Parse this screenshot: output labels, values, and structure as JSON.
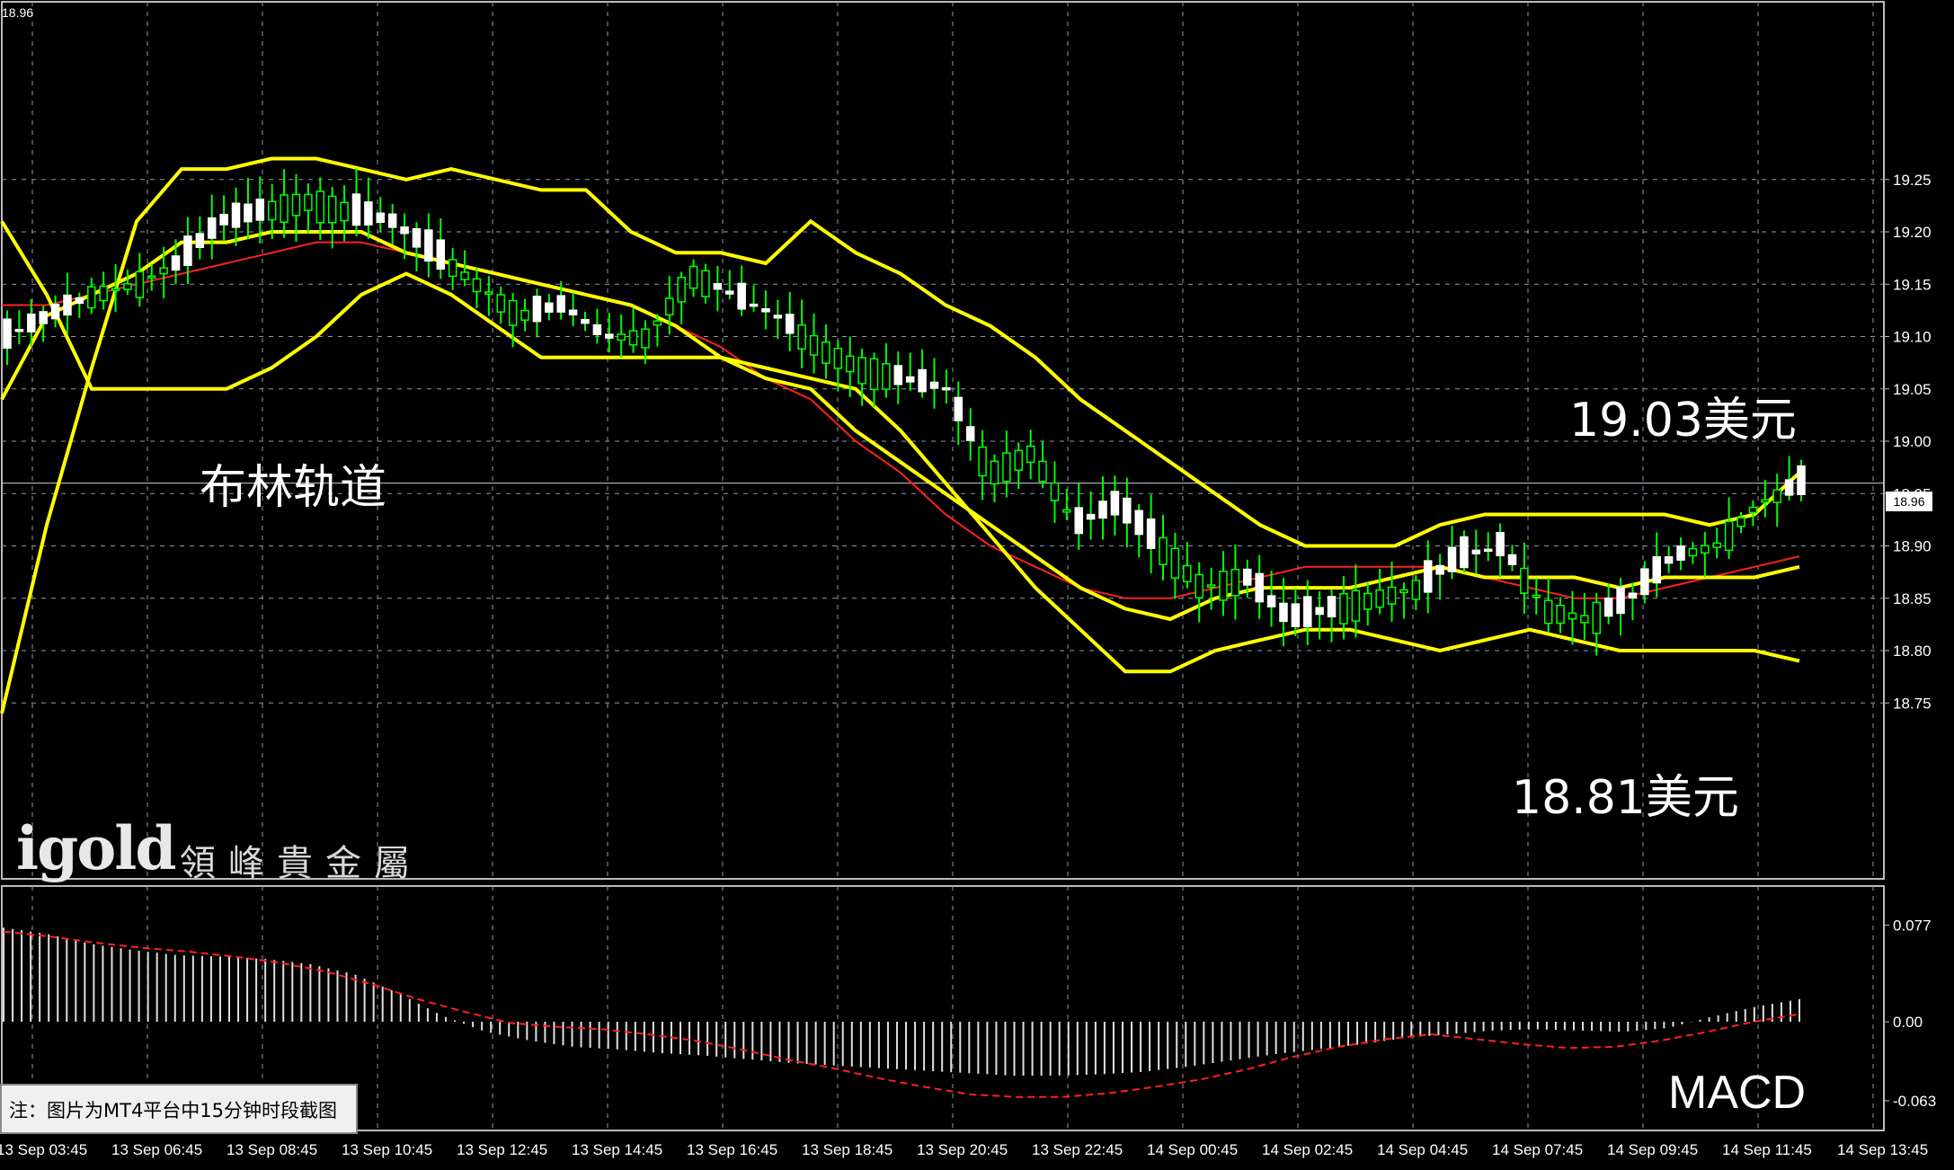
{
  "chart_data": [
    {
      "type": "line",
      "title": "",
      "ylim": [
        18.71,
        19.3
      ],
      "y_ticks": [
        "19.25",
        "19.20",
        "19.15",
        "19.10",
        "19.05",
        "19.00",
        "18.95",
        "18.90",
        "18.85",
        "18.80",
        "18.75"
      ],
      "top_left_label": "18.96",
      "current_price_label": "18.96",
      "current_price": 18.96,
      "grid": true,
      "colors": {
        "candle": "#00ff00",
        "bollinger": "#ffff00",
        "ma": "#ff2020",
        "grid": "#8a9aa8"
      },
      "series": [
        {
          "values": [
            18.74,
            18.92,
            19.07,
            19.21,
            19.26,
            19.26,
            19.27,
            19.27,
            19.26,
            19.25,
            19.26,
            19.25,
            19.24,
            19.24,
            19.2,
            19.18,
            19.18,
            19.17,
            19.21,
            19.18,
            19.16,
            19.13,
            19.11,
            19.08,
            19.04,
            19.01,
            18.98,
            18.95,
            18.92,
            18.9,
            18.9,
            18.9,
            18.92,
            18.93,
            18.93,
            18.93,
            18.93,
            18.93,
            18.92,
            18.93,
            18.97
          ]
        },
        {
          "values": [
            19.04,
            19.12,
            19.14,
            19.16,
            19.19,
            19.19,
            19.2,
            19.2,
            19.2,
            19.18,
            19.17,
            19.16,
            19.15,
            19.14,
            19.13,
            19.11,
            19.08,
            19.06,
            19.05,
            19.01,
            18.98,
            18.95,
            18.92,
            18.89,
            18.86,
            18.84,
            18.83,
            18.85,
            18.86,
            18.86,
            18.86,
            18.87,
            18.88,
            18.87,
            18.87,
            18.87,
            18.86,
            18.87,
            18.87,
            18.87,
            18.88
          ]
        },
        {
          "values": [
            19.13,
            19.13,
            19.14,
            19.15,
            19.16,
            19.17,
            19.18,
            19.19,
            19.19,
            19.18,
            19.17,
            19.16,
            19.15,
            19.14,
            19.13,
            19.11,
            19.09,
            19.06,
            19.04,
            19.0,
            18.97,
            18.93,
            18.9,
            18.88,
            18.86,
            18.85,
            18.85,
            18.86,
            18.87,
            18.88,
            18.88,
            18.88,
            18.88,
            18.87,
            18.86,
            18.85,
            18.85,
            18.86,
            18.87,
            18.88,
            18.89
          ]
        },
        {
          "values": [
            19.21,
            19.14,
            19.05,
            19.05,
            19.05,
            19.05,
            19.07,
            19.1,
            19.14,
            19.16,
            19.14,
            19.11,
            19.08,
            19.08,
            19.08,
            19.08,
            19.08,
            19.07,
            19.06,
            19.05,
            19.01,
            18.96,
            18.91,
            18.86,
            18.82,
            18.78,
            18.78,
            18.8,
            18.81,
            18.82,
            18.82,
            18.81,
            18.8,
            18.81,
            18.82,
            18.81,
            18.8,
            18.8,
            18.8,
            18.8,
            18.79
          ]
        },
        {
          "values": [
            19.1,
            19.12,
            19.14,
            19.15,
            19.17,
            19.21,
            19.22,
            19.23,
            19.22,
            19.21,
            19.18,
            19.15,
            19.12,
            19.13,
            19.1,
            19.1,
            19.16,
            19.14,
            19.12,
            19.09,
            19.07,
            19.06,
            19.05,
            18.97,
            18.99,
            18.92,
            18.94,
            18.9,
            18.86,
            18.87,
            18.83,
            18.84,
            18.85,
            18.86,
            18.89,
            18.9,
            18.84,
            18.83,
            18.85,
            18.89,
            18.9,
            18.94,
            18.96
          ]
        }
      ]
    },
    {
      "type": "bar",
      "title": "",
      "ylim": [
        -0.063,
        0.077
      ],
      "y_ticks": [
        "0.077",
        "0.00",
        "-0.063"
      ],
      "values": [
        0.075,
        0.07,
        0.062,
        0.057,
        0.053,
        0.052,
        0.05,
        0.046,
        0.038,
        0.023,
        0.005,
        -0.008,
        -0.015,
        -0.02,
        -0.022,
        -0.025,
        -0.027,
        -0.03,
        -0.033,
        -0.035,
        -0.037,
        -0.039,
        -0.041,
        -0.043,
        -0.043,
        -0.042,
        -0.04,
        -0.036,
        -0.031,
        -0.026,
        -0.022,
        -0.018,
        -0.013,
        -0.01,
        -0.007,
        -0.006,
        -0.007,
        -0.008,
        -0.005,
        0.004,
        0.012,
        0.018
      ],
      "signal": [
        0.072,
        0.068,
        0.063,
        0.059,
        0.056,
        0.052,
        0.047,
        0.04,
        0.03,
        0.018,
        0.008,
        -0.001,
        -0.004,
        -0.006,
        -0.01,
        -0.015,
        -0.022,
        -0.03,
        -0.037,
        -0.045,
        -0.052,
        -0.058,
        -0.06,
        -0.06,
        -0.057,
        -0.052,
        -0.046,
        -0.038,
        -0.028,
        -0.02,
        -0.014,
        -0.01,
        -0.014,
        -0.018,
        -0.021,
        -0.02,
        -0.015,
        -0.008,
        0.0,
        0.006
      ]
    }
  ],
  "x_ticks": [
    "13 Sep 03:45",
    "13 Sep 06:45",
    "13 Sep 08:45",
    "13 Sep 10:45",
    "13 Sep 12:45",
    "13 Sep 14:45",
    "13 Sep 16:45",
    "13 Sep 18:45",
    "13 Sep 20:45",
    "13 Sep 22:45",
    "14 Sep 00:45",
    "14 Sep 02:45",
    "14 Sep 04:45",
    "14 Sep 07:45",
    "14 Sep 09:45",
    "14 Sep 11:45",
    "14 Sep 13:45"
  ],
  "annotations": {
    "indicator": "布林轨道",
    "upper_price": "19.03美元",
    "lower_price": "18.81美元",
    "macd": "MACD",
    "note": "注：图片为MT4平台中15分钟时段截图"
  },
  "logo": {
    "latin": "igold",
    "chinese": "領峰貴金屬"
  }
}
